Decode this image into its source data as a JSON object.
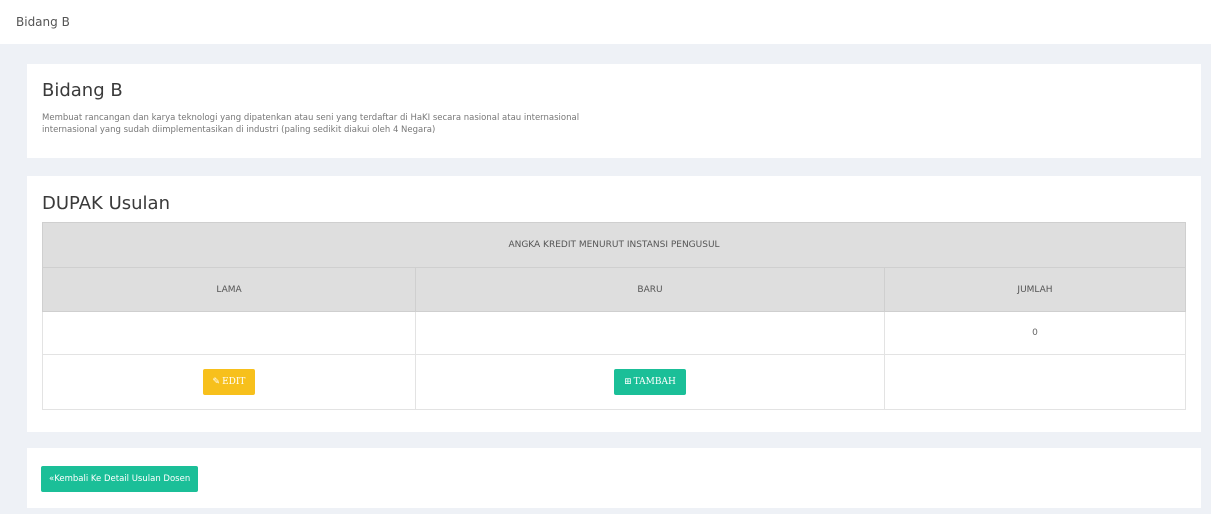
{
  "breadcrumb": "Bidang B",
  "info_card": {
    "title": "Bidang B",
    "description_line1": "Membuat rancangan dan karya teknologi yang dipatenkan atau seni yang terdaftar di HaKI secara nasional atau internasional",
    "description_line2": "internasional yang sudah diimplementasikan di industri (paling sedikit diakui oleh 4 Negara)"
  },
  "dupak_card": {
    "title": "DUPAK Usulan",
    "table": {
      "group_header": "ANGKA KREDIT MENURUT INSTANSI PENGUSUL",
      "columns": [
        "LAMA",
        "BARU",
        "JUMLAH"
      ],
      "values": [
        "",
        "",
        "0"
      ]
    },
    "edit_button": {
      "icon": "edit-icon",
      "label": "EDIT"
    },
    "add_button": {
      "icon": "plus-square-icon",
      "label": "TAMBAH"
    }
  },
  "back_button": {
    "icon": "double-left-arrow-icon",
    "label": "Kembali Ke Detail Usulan Dosen"
  },
  "colors": {
    "edit": "#f7c01c",
    "add": "#1bbf98",
    "background": "#eef1f6"
  }
}
